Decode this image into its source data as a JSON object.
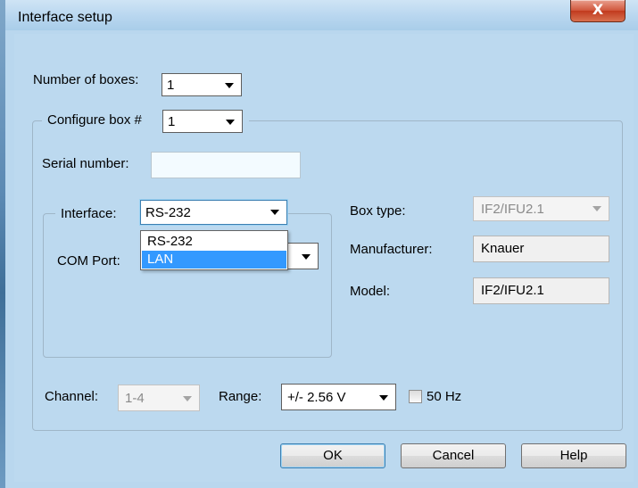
{
  "window": {
    "title": "Interface setup",
    "close_glyph": "X"
  },
  "number_of_boxes": {
    "label": "Number of boxes:",
    "value": "1"
  },
  "configure_box": {
    "label": "Configure box #",
    "value": "1"
  },
  "serial_number": {
    "label": "Serial number:",
    "value": ""
  },
  "interface": {
    "label": "Interface:",
    "value": "RS-232",
    "options": [
      "RS-232",
      "LAN"
    ],
    "highlighted": "LAN"
  },
  "com_port": {
    "label": "COM Port:",
    "value": ""
  },
  "box_type": {
    "label": "Box type:",
    "value": "IF2/IFU2.1"
  },
  "manufacturer": {
    "label": "Manufacturer:",
    "value": "Knauer"
  },
  "model": {
    "label": "Model:",
    "value": "IF2/IFU2.1"
  },
  "channel": {
    "label": "Channel:",
    "value": "1-4"
  },
  "range": {
    "label": "Range:",
    "value": "+/- 2.56 V"
  },
  "hz50": {
    "label": "50 Hz",
    "checked": false
  },
  "buttons": {
    "ok": "OK",
    "cancel": "Cancel",
    "help": "Help"
  },
  "colors": {
    "title_bar": "#b8d6ef",
    "close_button": "#c8452a",
    "selection": "#3399ff",
    "group_border": "#9fb6c8"
  },
  "icons": {
    "close": "close-icon",
    "dropdown": "chevron-down-icon"
  }
}
